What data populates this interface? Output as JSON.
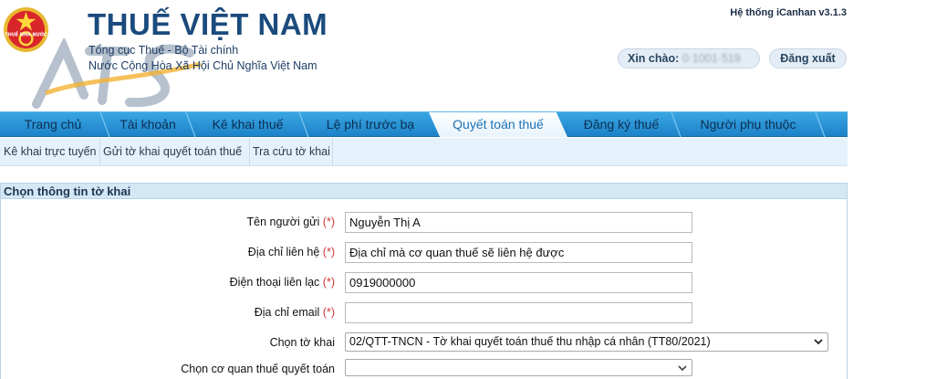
{
  "header": {
    "title": "THUẾ VIỆT NAM",
    "subtitle_1": "Tổng cục Thuế - Bộ Tài chính",
    "subtitle_2": "Nước Cộng Hòa Xã Hội Chủ Nghĩa Việt Nam",
    "emblem_text": "THUẾ NHÀ NƯỚC",
    "system_version": "Hệ thống iCanhan v3.1.3",
    "greeting_label": "Xin chào:",
    "greeting_user": "0·1001·519",
    "logout_label": "Đăng xuất"
  },
  "main_nav": {
    "items": [
      {
        "label": "Trang chủ"
      },
      {
        "label": "Tài khoản"
      },
      {
        "label": "Kê khai thuế"
      },
      {
        "label": "Lệ phí trước bạ"
      },
      {
        "label": "Quyết toán thuế",
        "active": true
      },
      {
        "label": "Đăng ký thuế"
      },
      {
        "label": "Người phụ thuộc"
      }
    ]
  },
  "sub_nav": {
    "items": [
      {
        "label": "Kê khai trực tuyến"
      },
      {
        "label": "Gửi tờ khai quyết toán thuế"
      },
      {
        "label": "Tra cứu tờ khai"
      }
    ]
  },
  "form": {
    "section_title": "Chọn thông tin tờ khai",
    "required_mark": "(*)",
    "fields": {
      "sender_name": {
        "label": "Tên người gửi",
        "value": "Nguyễn Thị  A"
      },
      "contact_address": {
        "label": "Địa chỉ liên hệ",
        "value": "Địa chỉ mà cơ quan thuế sẽ liên hệ được"
      },
      "phone": {
        "label": "Điện thoại liên lạc",
        "value": "0919000000"
      },
      "email": {
        "label": "Địa chỉ email",
        "value": ""
      },
      "declaration_type": {
        "label": "Chọn tờ khai",
        "value": "02/QTT-TNCN - Tờ khai quyết toán thuế thu nhập cá nhân (TT80/2021)"
      },
      "tax_office": {
        "label": "Chọn cơ quan thuế quyết toán",
        "value": ""
      }
    }
  },
  "colors": {
    "brand_blue": "#1b4b7d",
    "nav_blue": "#2b95d6",
    "required_red": "#d23636",
    "panel_header": "#d3e7f5"
  },
  "icons": [
    "emblem-icon",
    "watermark-logo",
    "chevron-down-icon"
  ]
}
